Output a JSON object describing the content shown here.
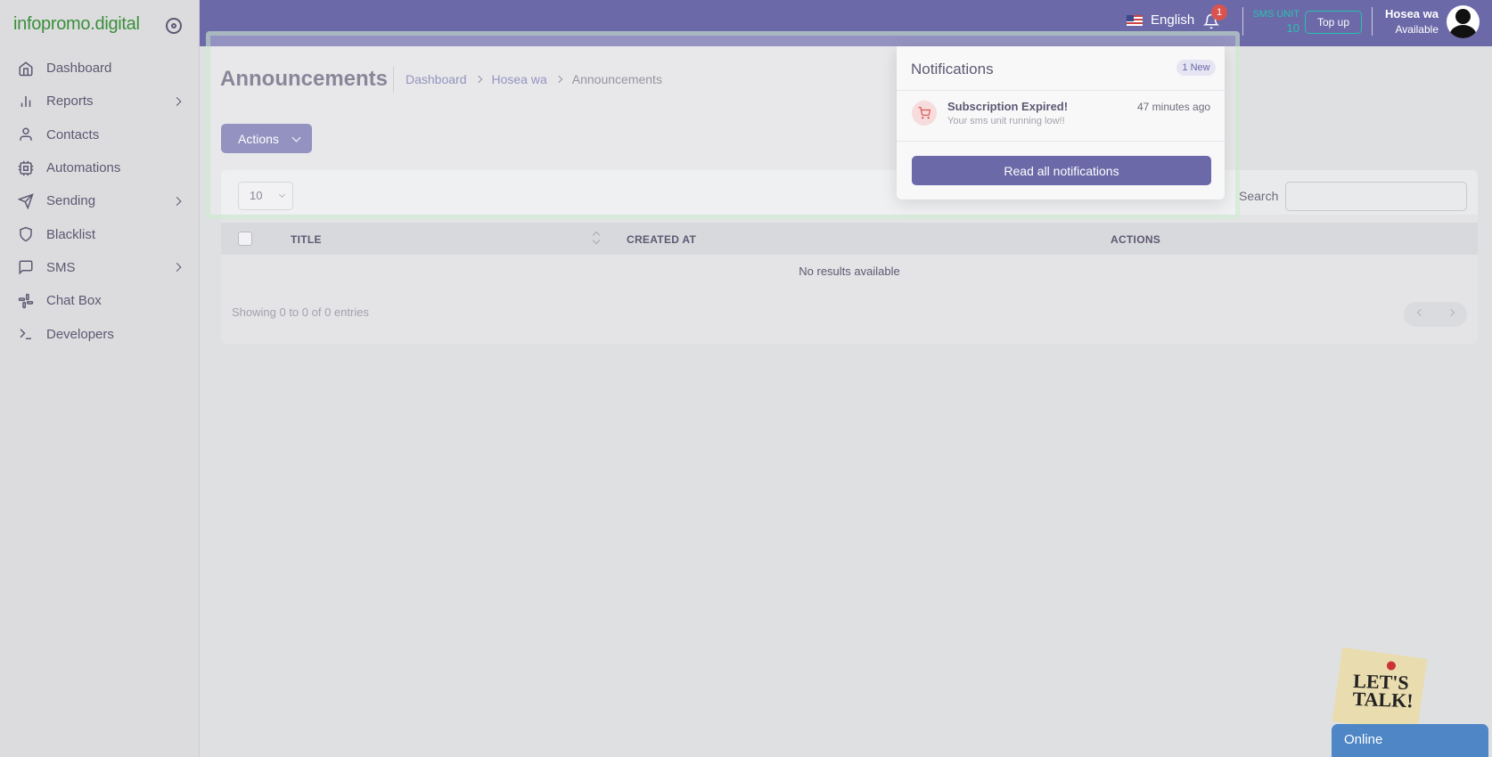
{
  "brand": {
    "name": "infopromo.digital"
  },
  "sidebar": {
    "items": [
      {
        "label": "Dashboard",
        "icon": "home-icon",
        "has_submenu": false
      },
      {
        "label": "Reports",
        "icon": "bar-chart-icon",
        "has_submenu": true
      },
      {
        "label": "Contacts",
        "icon": "user-icon",
        "has_submenu": false
      },
      {
        "label": "Automations",
        "icon": "cpu-icon",
        "has_submenu": false
      },
      {
        "label": "Sending",
        "icon": "send-icon",
        "has_submenu": true
      },
      {
        "label": "Blacklist",
        "icon": "shield-icon",
        "has_submenu": false
      },
      {
        "label": "SMS",
        "icon": "message-square-icon",
        "has_submenu": true
      },
      {
        "label": "Chat Box",
        "icon": "slack-icon",
        "has_submenu": false
      },
      {
        "label": "Developers",
        "icon": "terminal-icon",
        "has_submenu": false
      }
    ]
  },
  "header": {
    "language": "English",
    "notification_count": "1",
    "sms_unit_label": "SMS UNIT",
    "sms_unit_value": "10",
    "topup_label": "Top up",
    "user_name": "Hosea wa",
    "user_status": "Available"
  },
  "page": {
    "title": "Announcements",
    "breadcrumb": [
      "Dashboard",
      "Hosea wa",
      "Announcements"
    ],
    "actions_label": "Actions"
  },
  "table": {
    "page_length": "10",
    "search_label": "Search",
    "columns": [
      "TITLE",
      "CREATED AT",
      "ACTIONS"
    ],
    "empty_text": "No results available",
    "info_text": "Showing 0 to 0 of 0 entries"
  },
  "notifications": {
    "title": "Notifications",
    "badge": "1 New",
    "items": [
      {
        "title": "Subscription Expired!",
        "subtitle": "Your sms unit running low!!",
        "time": "47 minutes ago",
        "icon": "shopping-cart-icon"
      }
    ],
    "read_all_label": "Read all notifications"
  },
  "chat": {
    "sticker_text": "LET'S TALK!",
    "status_label": "Online"
  },
  "colors": {
    "primary": "#6b69a8",
    "teal": "#27c2b0",
    "brand_green": "#3a8f3a",
    "danger": "#d9534f",
    "chat_blue": "#4f86c6"
  }
}
